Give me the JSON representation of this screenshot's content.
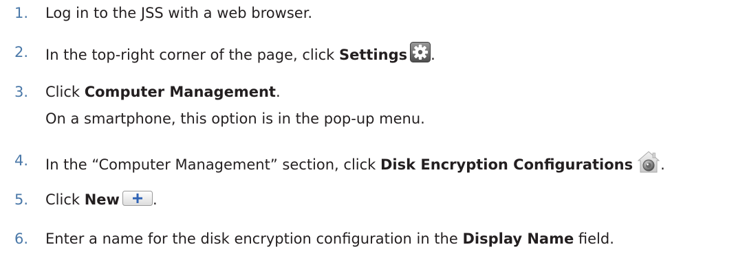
{
  "steps": [
    {
      "number": "1.",
      "parts": [
        "Log in to the JSS with a web browser."
      ]
    },
    {
      "number": "2.",
      "pre": "In the top-right corner of the page, click ",
      "bold": "Settings",
      "icon": "gear-icon",
      "post": "."
    },
    {
      "number": "3.",
      "pre": "Click ",
      "bold": "Computer Management",
      "post": ".",
      "note": "On a smartphone, this option is in the pop-up menu."
    },
    {
      "number": "4.",
      "pre": "In the “Computer Management” section, click ",
      "bold": "Disk Encryption Configurations",
      "icon": "disk-encryption-icon",
      "post": "."
    },
    {
      "number": "5.",
      "pre": "Click ",
      "bold": "New",
      "icon": "plus-icon",
      "post": "."
    },
    {
      "number": "6.",
      "pre": "Enter a name for the disk encryption configuration in the ",
      "bold": "Display Name",
      "post": " field."
    }
  ],
  "colors": {
    "step_number": "#4a78a8",
    "body_text": "#231f20"
  }
}
